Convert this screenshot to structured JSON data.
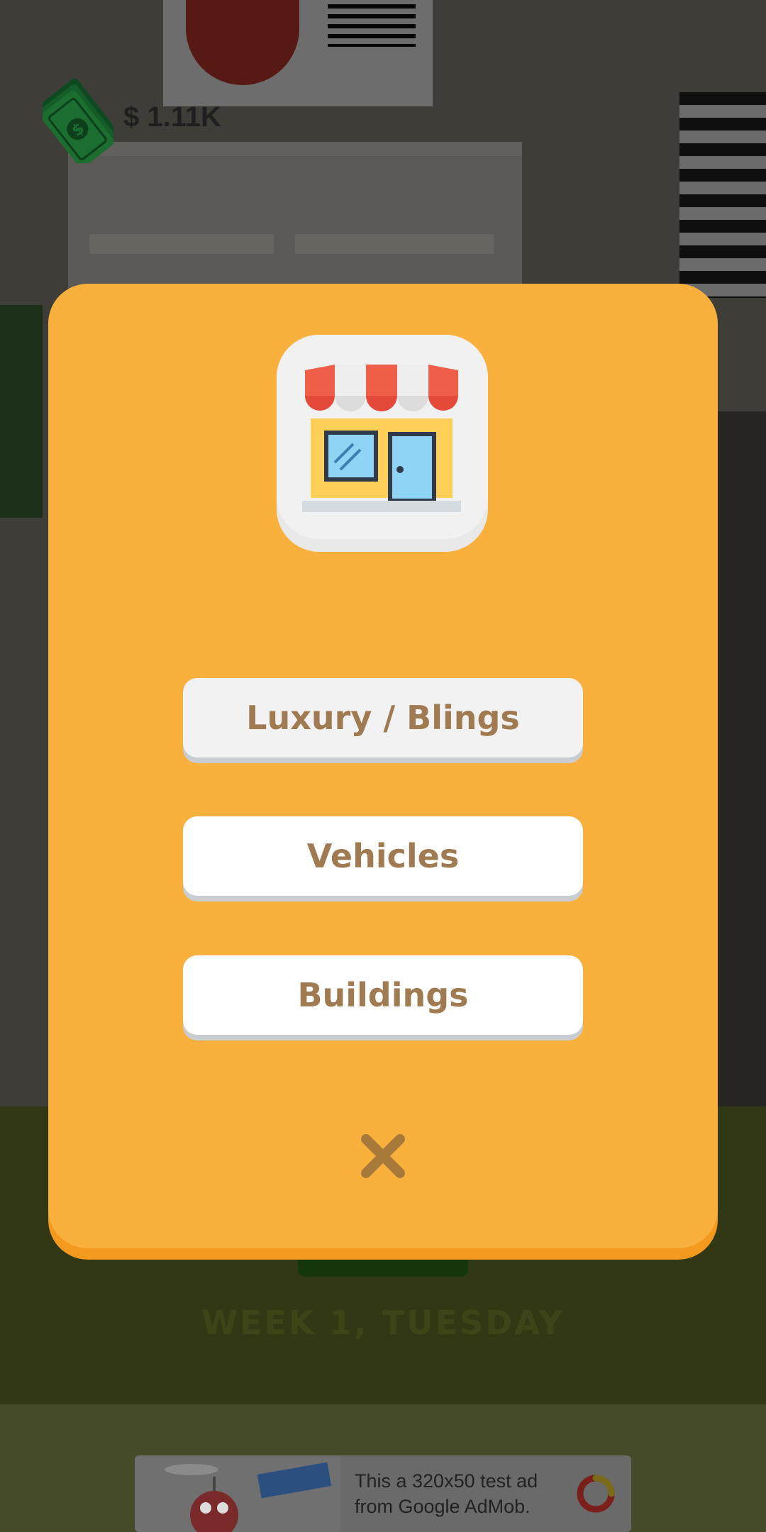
{
  "hud": {
    "money": "$ 1.11K",
    "date": "WEEK 1, TUESDAY",
    "icons": {
      "money": "cash-bill-icon"
    }
  },
  "modal": {
    "icon": "shop-storefront-icon",
    "options": [
      {
        "label": "Luxury / Blings",
        "selected": true
      },
      {
        "label": "Vehicles",
        "selected": false
      },
      {
        "label": "Buildings",
        "selected": false
      }
    ],
    "close_icon": "close-x-icon"
  },
  "ad": {
    "line1": "This a 320x50 test ad",
    "line2": "from Google AdMob."
  },
  "colors": {
    "modal_bg": "#f9b03c",
    "modal_shadow": "#f39a1f",
    "button_text": "#a07a50",
    "close_x": "#a77a3a"
  }
}
